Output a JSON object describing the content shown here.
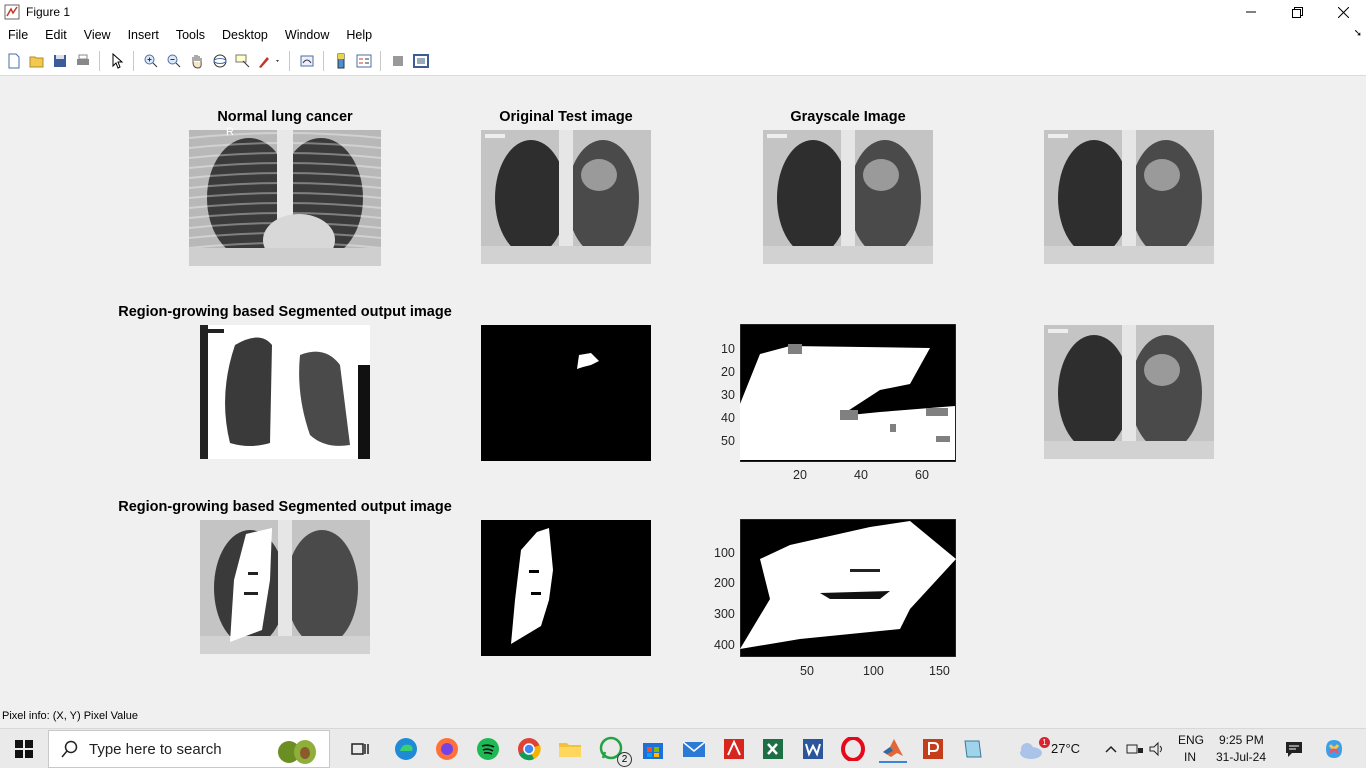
{
  "window": {
    "title": "Figure 1"
  },
  "menu": [
    "File",
    "Edit",
    "View",
    "Insert",
    "Tools",
    "Desktop",
    "Window",
    "Help"
  ],
  "toolbar_icons": [
    "new-figure-icon",
    "open-file-icon",
    "save-icon",
    "print-icon",
    "select-arrow-icon",
    "zoom-in-icon",
    "zoom-out-icon",
    "pan-hand-icon",
    "rotate-3d-icon",
    "data-cursor-icon",
    "brush-icon",
    "link-plot-icon",
    "insert-colorbar-icon",
    "insert-legend-icon",
    "hide-plot-tools-icon",
    "show-plot-tools-icon"
  ],
  "subplots": {
    "row1": {
      "a": {
        "title": "Normal lung cancer",
        "marker": "R"
      },
      "b": {
        "title": "Original Test image"
      },
      "c": {
        "title": "Grayscale Image"
      },
      "d": {
        "title": ""
      }
    },
    "row2": {
      "a": {
        "title": "Region-growing based Segmented output image"
      },
      "c": {
        "yticks": [
          "10",
          "20",
          "30",
          "40",
          "50"
        ],
        "xticks": [
          "20",
          "40",
          "60"
        ]
      }
    },
    "row3": {
      "a": {
        "title": "Region-growing based Segmented output image"
      },
      "c": {
        "yticks": [
          "100",
          "200",
          "300",
          "400"
        ],
        "xticks": [
          "50",
          "100",
          "150"
        ]
      }
    }
  },
  "status": {
    "pixel_info": "Pixel info: (X, Y)  Pixel Value"
  },
  "taskbar": {
    "search_placeholder": "Type here to search",
    "whatsapp_badge": "2",
    "weather_badge": "1",
    "temperature": "27°C",
    "lang_1": "ENG",
    "lang_2": "IN",
    "time": "9:25 PM",
    "date": "31-Jul-24"
  },
  "colors": {
    "figure_bg": "#f0f0f0",
    "taskbar_bg": "#eaeaea",
    "accent_matlab": "#e16737"
  }
}
